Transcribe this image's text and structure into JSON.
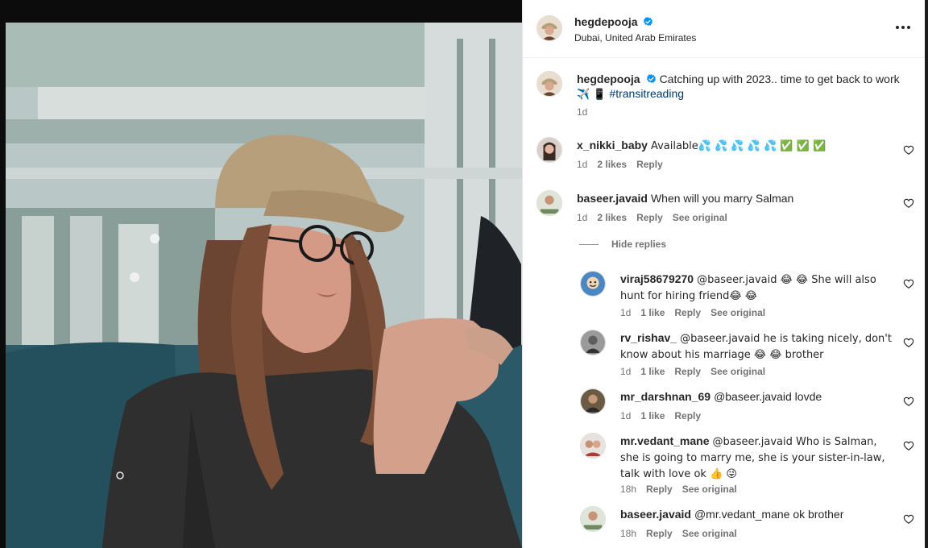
{
  "post": {
    "author": "hegdepooja",
    "verified": true,
    "location": "Dubai, United Arab Emirates",
    "caption_text": "Catching up with 2023.. time to get back to work",
    "caption_emojis": "✈️ 📱",
    "caption_hashtag": "#transitreading",
    "caption_time": "1d",
    "more_icon": "more-options-icon"
  },
  "comments": [
    {
      "user": "x_nikki_baby",
      "text": "Available💦 💦 💦 💦 💦 ✅ ✅ ✅",
      "time": "1d",
      "likes": "2 likes",
      "reply": "Reply",
      "see_original": ""
    },
    {
      "user": "baseer.javaid",
      "text": "When will you marry Salman",
      "time": "1d",
      "likes": "2 likes",
      "reply": "Reply",
      "see_original": "See original"
    }
  ],
  "hide_replies_label": "Hide replies",
  "replies": [
    {
      "user": "viraj58679270",
      "text": "@baseer.javaid 😂 😂  She will also hunt for hiring friend😂 😂",
      "time": "1d",
      "likes": "1 like",
      "reply": "Reply",
      "see_original": "See original"
    },
    {
      "user": "rv_rishav_",
      "text": "@baseer.javaid he is taking nicely, don't know about his marriage 😂 😂 brother",
      "time": "1d",
      "likes": "1 like",
      "reply": "Reply",
      "see_original": "See original"
    },
    {
      "user": "mr_darshnan_69",
      "text": "@baseer.javaid lovde",
      "time": "1d",
      "likes": "1 like",
      "reply": "Reply",
      "see_original": ""
    },
    {
      "user": "mr.vedant_mane",
      "text": "@baseer.javaid Who is Salman, she is going to marry me, she is your sister-in-law, talk with love ok 👍 😜",
      "time": "18h",
      "likes": "",
      "reply": "Reply",
      "see_original": "See original"
    },
    {
      "user": "baseer.javaid",
      "text": "@mr.vedant_mane ok brother",
      "time": "18h",
      "likes": "",
      "reply": "Reply",
      "see_original": "See original"
    }
  ],
  "colors": {
    "verified_blue": "#0095f6",
    "meta_gray": "#737373",
    "hashtag_blue": "#00376b"
  }
}
